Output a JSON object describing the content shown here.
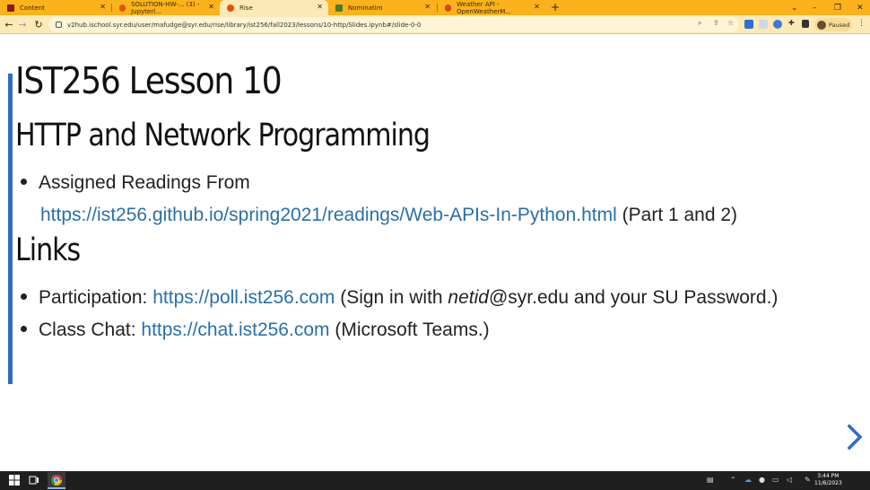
{
  "browser": {
    "tabs": [
      {
        "label": "Content",
        "fav_color": "#8b1a1a",
        "active": false
      },
      {
        "label": "SOLUTION-HW-... (3) - Jupyterl...",
        "fav_color": "#e65100",
        "active": false
      },
      {
        "label": "Rise",
        "fav_color": "#e65100",
        "active": true
      },
      {
        "label": "Nominatim",
        "fav_color": "#4a7a2a",
        "active": false
      },
      {
        "label": "Weather API - OpenWeatherM...",
        "fav_color": "#d84315",
        "active": false
      }
    ],
    "new_tab_glyph": "+",
    "address": "v2hub.ischool.syr.edu/user/mafudge@syr.edu/rise/library/ist256/fall2023/lessons/10-http/Slides.ipynb#/slide-0-0",
    "profile_status": "Paused"
  },
  "slide": {
    "title": "IST256 Lesson 10",
    "subtitle": "HTTP and Network Programming",
    "readings_label": "Assigned Readings From",
    "readings_link": "https://ist256.github.io/spring2021/readings/Web-APIs-In-Python.html",
    "readings_suffix": "(Part 1 and 2)",
    "links_heading": "Links",
    "participation_label": "Participation:",
    "participation_link": "https://poll.ist256.com",
    "participation_note_pre": "(Sign in with ",
    "participation_note_em": "netid",
    "participation_note_post": "@syr.edu and your SU Password.)",
    "chat_label": "Class Chat:",
    "chat_link": "https://chat.ist256.com",
    "chat_note": "(Microsoft Teams.)"
  },
  "taskbar": {
    "time": "3:44 PM",
    "date": "11/6/2023"
  },
  "colors": {
    "tab_strip": "#fbb21c",
    "toolbar": "#fde9b6",
    "accent_bar": "#2f6bc5",
    "link": "#2a6fa8",
    "taskbar": "#1f1f1f"
  }
}
